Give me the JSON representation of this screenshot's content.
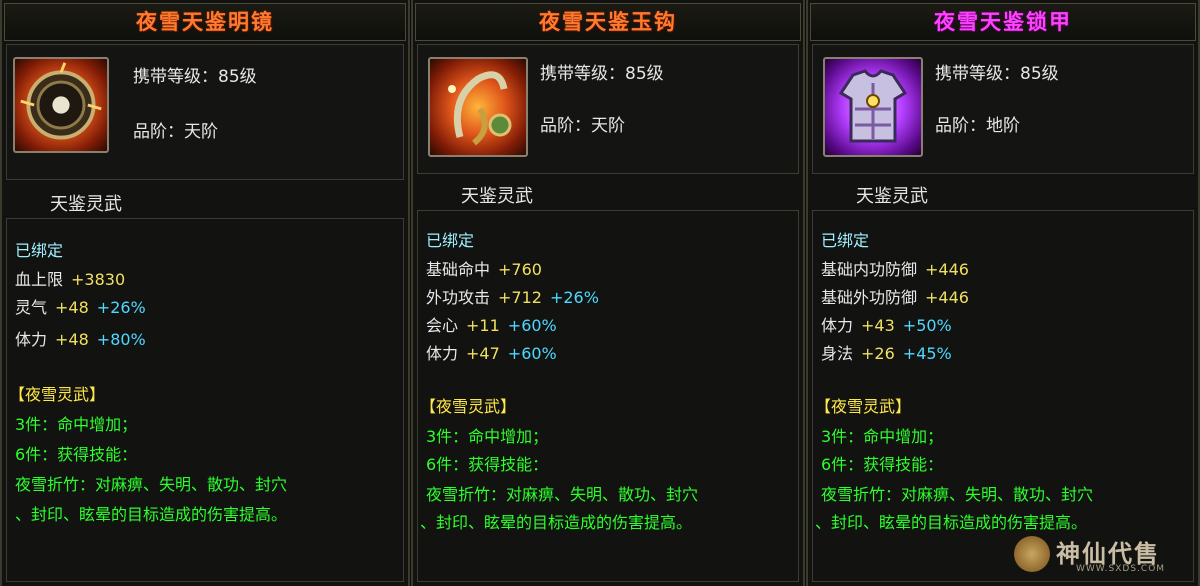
{
  "panels": [
    {
      "title": "夜雪天鉴明镜",
      "title_color": "#ff7a2e",
      "icon": "bronze-mirror-icon",
      "level_label": "携带等级：85级",
      "grade_label": "品阶：天阶",
      "subtitle": "天鉴灵武",
      "bound": "已绑定",
      "stats": [
        {
          "name": "血上限",
          "value": "+3830",
          "pct": ""
        },
        {
          "name": "灵气",
          "value": "+48",
          "pct": "+26%"
        },
        {
          "name": "体力",
          "value": "+48",
          "pct": "+80%"
        }
      ],
      "set_name": "【夜雪灵武】",
      "set_3": "3件：命中增加；",
      "set_6": "6件：获得技能：",
      "skill_line1": "夜雪折竹：对麻痹、失明、散功、封穴",
      "skill_line2": "、封印、眩晕的目标造成的伤害提高。"
    },
    {
      "title": "夜雪天鉴玉钩",
      "title_color": "#ff7a2e",
      "icon": "jade-hook-icon",
      "level_label": "携带等级：85级",
      "grade_label": "品阶：天阶",
      "subtitle": "天鉴灵武",
      "bound": "已绑定",
      "stats": [
        {
          "name": "基础命中",
          "value": "+760",
          "pct": ""
        },
        {
          "name": "外功攻击",
          "value": "+712",
          "pct": "+26%"
        },
        {
          "name": "会心",
          "value": "+11",
          "pct": "+60%"
        },
        {
          "name": "体力",
          "value": "+47",
          "pct": "+60%"
        }
      ],
      "set_name": "【夜雪灵武】",
      "set_3": "3件：命中增加；",
      "set_6": "6件：获得技能：",
      "skill_line1": "夜雪折竹：对麻痹、失明、散功、封穴",
      "skill_line2": "、封印、眩晕的目标造成的伤害提高。"
    },
    {
      "title": "夜雪天鉴锁甲",
      "title_color": "#ff42ff",
      "icon": "armor-vest-icon",
      "level_label": "携带等级：85级",
      "grade_label": "品阶：地阶",
      "subtitle": "天鉴灵武",
      "bound": "已绑定",
      "stats": [
        {
          "name": "基础内功防御",
          "value": "+446",
          "pct": ""
        },
        {
          "name": "基础外功防御",
          "value": "+446",
          "pct": ""
        },
        {
          "name": "体力",
          "value": "+43",
          "pct": "+50%"
        },
        {
          "name": "身法",
          "value": "+26",
          "pct": "+45%"
        }
      ],
      "set_name": "【夜雪灵武】",
      "set_3": "3件：命中增加；",
      "set_6": "6件：获得技能：",
      "skill_line1": "夜雪折竹：对麻痹、失明、散功、封穴",
      "skill_line2": "、封印、眩晕的目标造成的伤害提高。"
    }
  ],
  "watermark": {
    "text": "神仙代售",
    "url": "WWW.SXDS.COM"
  }
}
